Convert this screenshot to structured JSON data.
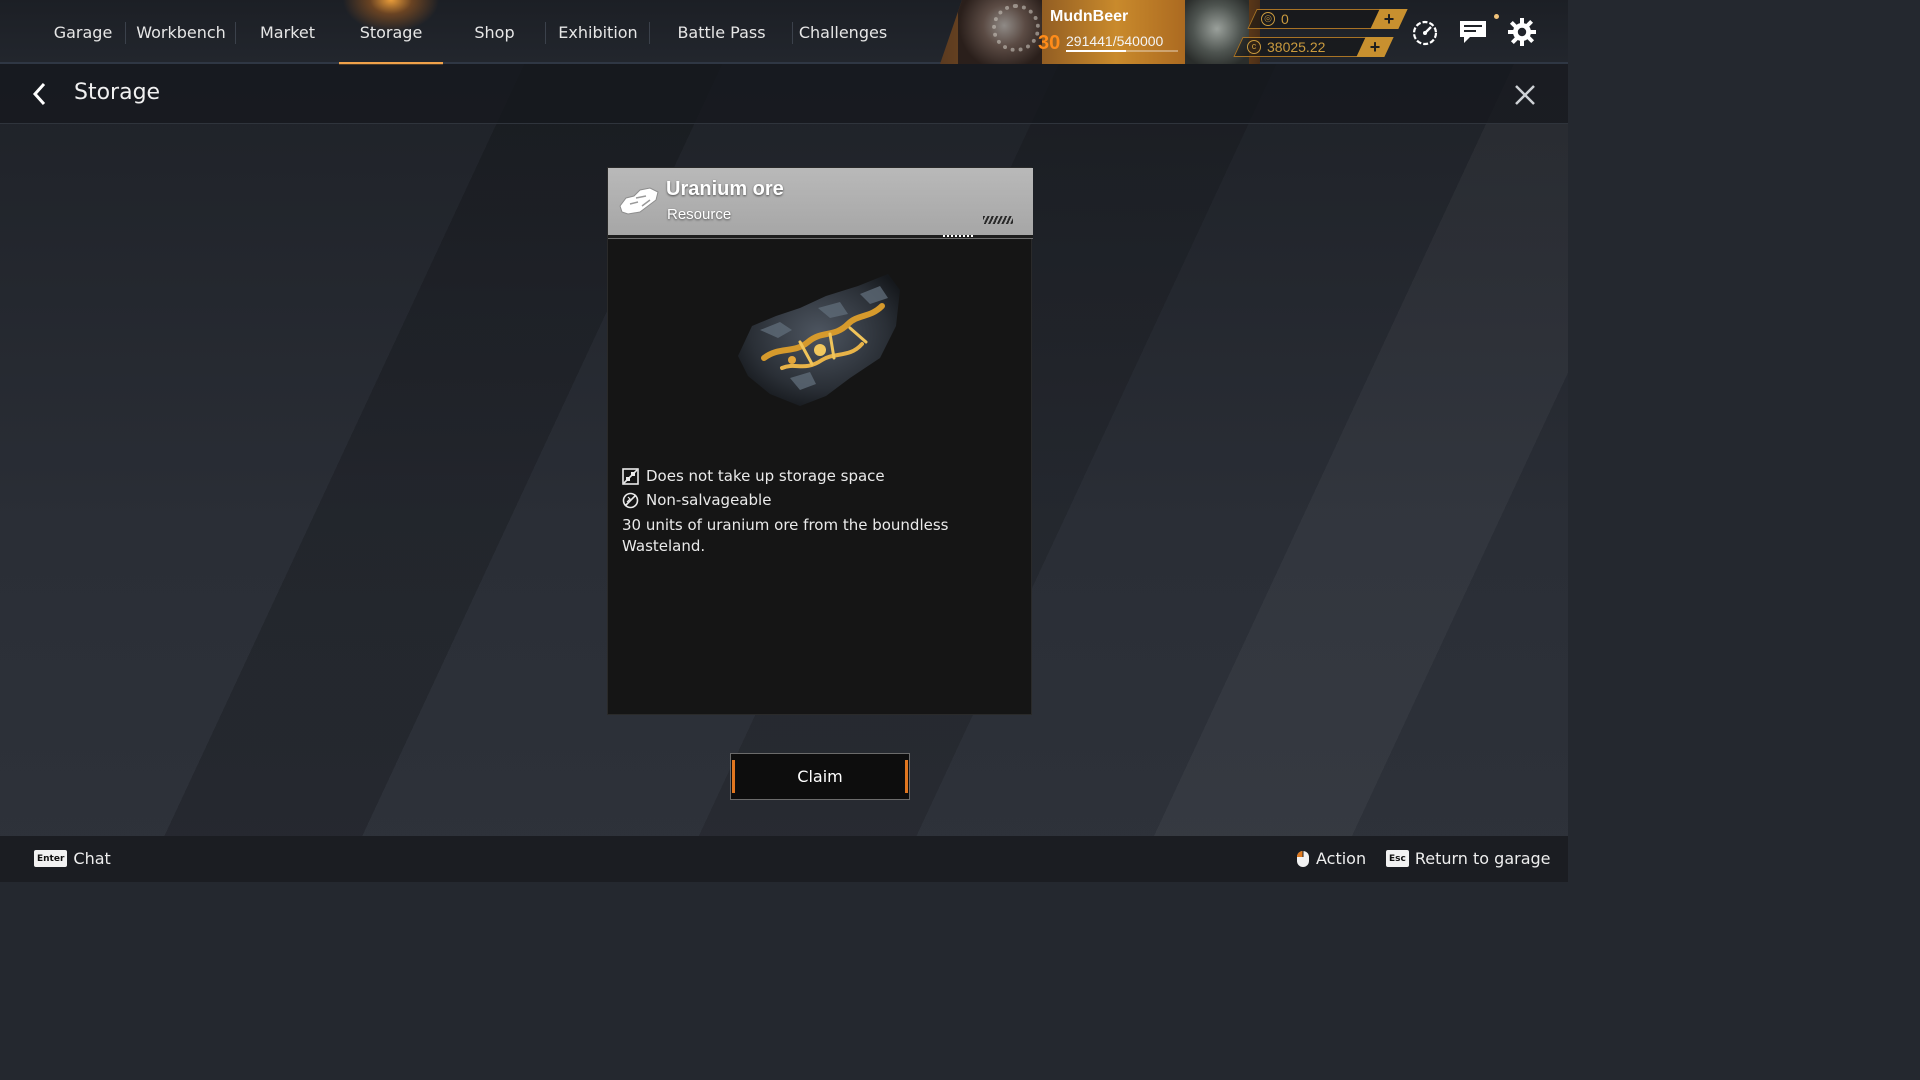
{
  "nav": {
    "tabs": [
      {
        "label": "Garage",
        "active": false
      },
      {
        "label": "Workbench",
        "active": false
      },
      {
        "label": "Market",
        "active": false
      },
      {
        "label": "Storage",
        "active": true
      },
      {
        "label": "Shop",
        "active": false
      },
      {
        "label": "Exhibition",
        "active": false
      },
      {
        "label": "Battle Pass",
        "active": false
      },
      {
        "label": "Challenges",
        "active": false
      }
    ]
  },
  "player": {
    "name": "MudnBeer",
    "level": "30",
    "xp_text": "291441/540000",
    "xp_progress": 0.54
  },
  "currencies": [
    {
      "icon": "coupon-icon",
      "value": "0"
    },
    {
      "icon": "coin-icon",
      "value": "38025.22"
    }
  ],
  "header": {
    "title": "Storage"
  },
  "item": {
    "name": "Uranium ore",
    "type": "Resource",
    "properties": [
      {
        "icon": "no-storage-icon",
        "text": "Does not take up storage space"
      },
      {
        "icon": "non-salvageable-icon",
        "text": "Non-salvageable"
      }
    ],
    "description": "30 units of uranium ore from the boundless Wasteland."
  },
  "claim_label": "Claim",
  "footer": {
    "chat_key": "Enter",
    "chat_label": "Chat",
    "action_label": "Action",
    "return_key": "Esc",
    "return_label": "Return to garage"
  },
  "colors": {
    "accent": "#f0a24a",
    "level": "#ff8c1a",
    "claim_edge": "#e0761f",
    "card_header": "#b3b3b3"
  }
}
